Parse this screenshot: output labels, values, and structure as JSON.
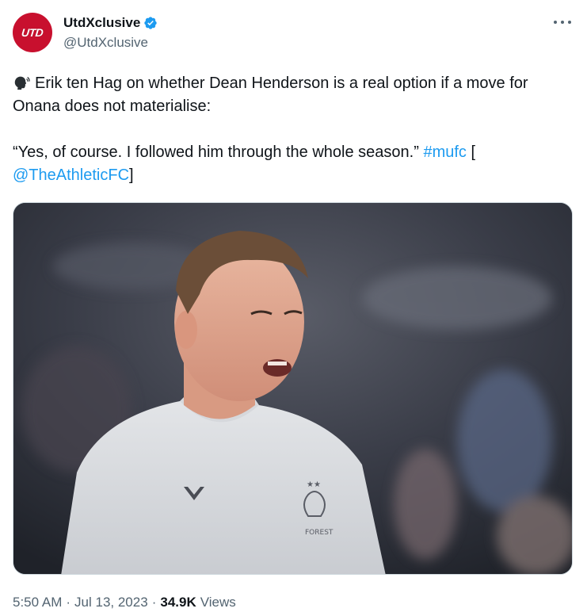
{
  "author": {
    "display_name": "UtdXclusive",
    "handle": "@UtdXclusive",
    "avatar_text": "UTD",
    "verified": true,
    "verified_color": "#1d9bf0",
    "avatar_color": "#c8102e"
  },
  "tweet": {
    "line1_prefix": "Erik ten Hag on whether Dean Henderson is a real option if a move for Onana does not materialise:",
    "quote": "“Yes, of course. I followed him through the whole season.”",
    "hashtag": "#mufc",
    "bracket_open": "[",
    "mention": "@TheAthleticFC",
    "bracket_close": "]",
    "emoji_icon": "speaking-head-icon"
  },
  "media": {
    "alt": "Dean Henderson in a grey Nottingham Forest training top",
    "crest_text": "FOREST"
  },
  "meta": {
    "time": "5:50 AM",
    "date": "Jul 13, 2023",
    "views_count": "34.9K",
    "views_label": "Views"
  },
  "colors": {
    "link": "#1d9bf0",
    "secondary_text": "#536471",
    "primary_text": "#0f1419"
  }
}
